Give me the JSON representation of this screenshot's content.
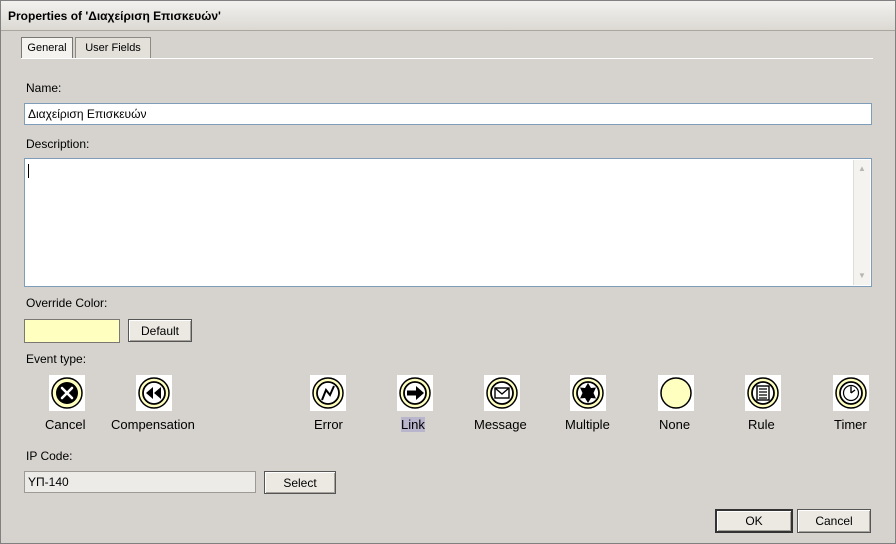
{
  "window": {
    "title": "Properties of 'Διαχείριση Επισκευών'"
  },
  "tabs": [
    {
      "label": "General",
      "active": true
    },
    {
      "label": "User Fields",
      "active": false
    }
  ],
  "name": {
    "label": "Name:",
    "value": "Διαχείριση Επισκευών"
  },
  "description": {
    "label": "Description:",
    "value": ""
  },
  "override_color": {
    "label": "Override Color:",
    "swatch": "#ffffc0",
    "default_label": "Default"
  },
  "event_type": {
    "label": "Event type:",
    "selected": "Link",
    "items": [
      {
        "label": "Cancel",
        "icon": "cancel-icon"
      },
      {
        "label": "Compensation",
        "icon": "compensation-icon"
      },
      {
        "label": "Error",
        "icon": "error-icon"
      },
      {
        "label": "Link",
        "icon": "link-icon"
      },
      {
        "label": "Message",
        "icon": "message-icon"
      },
      {
        "label": "Multiple",
        "icon": "multiple-icon"
      },
      {
        "label": "None",
        "icon": "none-icon"
      },
      {
        "label": "Rule",
        "icon": "rule-icon"
      },
      {
        "label": "Timer",
        "icon": "timer-icon"
      }
    ]
  },
  "ip_code": {
    "label": "IP Code:",
    "value": "ΥΠ-140",
    "select_label": "Select"
  },
  "footer": {
    "ok_label": "OK",
    "cancel_label": "Cancel"
  },
  "colors": {
    "icon_fill": "#ffffc0",
    "selection_highlight": "#b8b5cc",
    "input_border": "#7f9db9"
  }
}
